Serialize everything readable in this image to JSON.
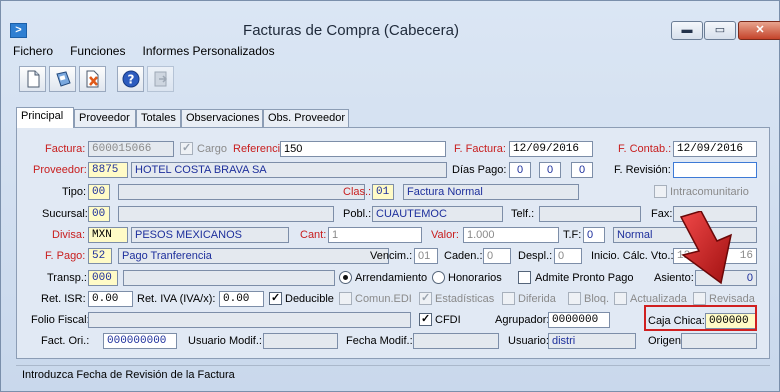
{
  "window": {
    "title": "Facturas de Compra (Cabecera)",
    "app_icon": "chevron-right-icon",
    "min_glyph": "▬",
    "max_glyph": "▭",
    "close_glyph": "✕"
  },
  "menu": [
    "Fichero",
    "Funciones",
    "Informes Personalizados"
  ],
  "toolbar": [
    "new-document-icon",
    "save-disk-icon",
    "delete-document-icon",
    "help-icon",
    "exit-icon"
  ],
  "tabs": [
    "Principal",
    "Proveedor",
    "Totales",
    "Observaciones",
    "Obs. Proveedor"
  ],
  "form": {
    "factura_label": "Factura:",
    "factura_value": "600015066",
    "cargo_label": "Cargo",
    "referencia_label": "Referencia:",
    "referencia_value": "150",
    "f_factura_label": "F. Factura:",
    "f_factura_value": "12/09/2016",
    "f_contab_label": "F. Contab.:",
    "f_contab_value": "12/09/2016",
    "proveedor_label": "Proveedor:",
    "proveedor_code": "8875",
    "proveedor_name": "HOTEL COSTA BRAVA SA",
    "dias_pago_label": "Días Pago:",
    "dias_pago_1": "0",
    "dias_pago_2": "0",
    "dias_pago_3": "0",
    "f_revision_label": "F. Revisión:",
    "f_revision_value": "",
    "tipo_label": "Tipo:",
    "tipo_code": "00",
    "clas_label": "Clas.:",
    "clas_code": "01",
    "clas_name": "Factura Normal",
    "intracom_label": "Intracomunitario",
    "sucursal_label": "Sucursal:",
    "sucursal_code": "00",
    "pobl_label": "Pobl.:",
    "pobl_value": "CUAUTEMOC",
    "telf_label": "Telf.:",
    "fax_label": "Fax:",
    "divisa_label": "Divisa:",
    "divisa_code": "MXN",
    "divisa_name": "PESOS MEXICANOS",
    "cant_label": "Cant:",
    "cant_value": "1",
    "valor_label": "Valor:",
    "valor_value": "1.000",
    "tf_label": "T.F:",
    "tf_code": "0",
    "tf_name": "Normal",
    "f_pago_label": "F. Pago:",
    "f_pago_code": "52",
    "f_pago_name": "Pago Tranferencia",
    "vencim_label": "Vencim.:",
    "vencim_value": "01",
    "caden_label": "Caden.:",
    "caden_value": "0",
    "despl_label": "Despl.:",
    "despl_value": "0",
    "inicio_label": "Inicio. Cálc. Vto.:",
    "inicio_value": "12",
    "inicio_tail": "16",
    "transp_label": "Transp.:",
    "transp_code": "000",
    "arrend_label": "Arrendamiento",
    "honor_label": "Honorarios",
    "pronto_label": "Admite Pronto Pago",
    "asiento_label": "Asiento:",
    "asiento_value": "0",
    "ret_isr_label": "Ret. ISR:",
    "ret_isr_value": "0.00",
    "ret_iva_label": "Ret. IVA (IVA/x):",
    "ret_iva_value": "0.00",
    "deducible_label": "Deducible",
    "comun_label": "Comun.EDI",
    "estad_label": "Estadísticas",
    "diferida_label": "Diferida",
    "bloq_label": "Bloq.",
    "actualizada_label": "Actualizada",
    "revisada_label": "Revisada",
    "folio_label": "Folio Fiscal:",
    "folio_value": "",
    "cfdi_label": "CFDI",
    "agrupador_label": "Agrupador:",
    "agrupador_value": "0000000",
    "caja_label": "Caja Chica:",
    "caja_value": "000000",
    "fact_ori_label": "Fact. Ori.:",
    "fact_ori_value": "000000000",
    "umodif_label": "Usuario Modif.:",
    "fmodif_label": "Fecha Modif.:",
    "usuario_label": "Usuario:",
    "usuario_value": "distri",
    "origen_label": "Origen:"
  },
  "status": {
    "text": "Introduzca Fecha de Revisión de la Factura"
  },
  "colors": {
    "required_label": "#c81e1e",
    "value_blue": "#1d2f9c",
    "yellow_field": "#fffbc7",
    "highlight": "#d02020"
  }
}
